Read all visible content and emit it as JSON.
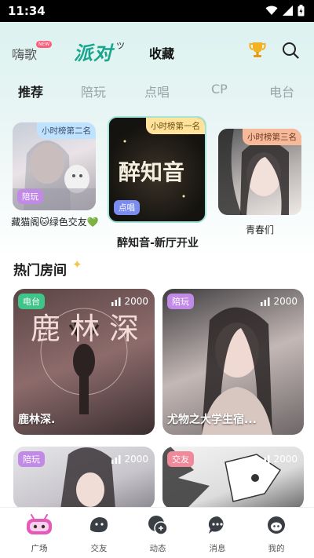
{
  "status_bar": {
    "time": "11:34"
  },
  "header": {
    "haige": "嗨歌",
    "new_badge": "NEW",
    "party": "派对",
    "favorites": "收藏"
  },
  "tabs": [
    "推荐",
    "陪玩",
    "点唱",
    "CP",
    "电台"
  ],
  "featured": [
    {
      "rank": "小时榜第二名",
      "tag": "陪玩",
      "tag_color": "#c08ae6",
      "name": "藏猫阁🐱绿色交友💚"
    },
    {
      "rank": "小时榜第一名",
      "tag": "点唱",
      "tag_color": "#7b8cf0",
      "name": "醉知音-新厅开业",
      "cover_text": "醉知音"
    },
    {
      "rank": "小时榜第三名",
      "tag": "",
      "tag_color": "",
      "name": "青春们"
    }
  ],
  "section": {
    "hot_rooms": "热门房间"
  },
  "rooms": [
    {
      "tag": "电台",
      "tag_color": "#3fc48a",
      "count": "2000",
      "title": "鹿林深.",
      "cover_text": "鹿 林 深"
    },
    {
      "tag": "陪玩",
      "tag_color": "#c08ae6",
      "count": "2000",
      "title": "尤物之大学生宿..."
    },
    {
      "tag": "陪玩",
      "tag_color": "#c08ae6",
      "count": "2000",
      "title": ""
    },
    {
      "tag": "交友",
      "tag_color": "#f08a9a",
      "count": "2000",
      "title": ""
    }
  ],
  "tabbar": [
    {
      "label": "广场",
      "icon": "plaza-icon"
    },
    {
      "label": "交友",
      "icon": "friends-icon"
    },
    {
      "label": "动态",
      "icon": "feed-icon"
    },
    {
      "label": "消息",
      "icon": "message-icon"
    },
    {
      "label": "我的",
      "icon": "profile-icon"
    }
  ]
}
